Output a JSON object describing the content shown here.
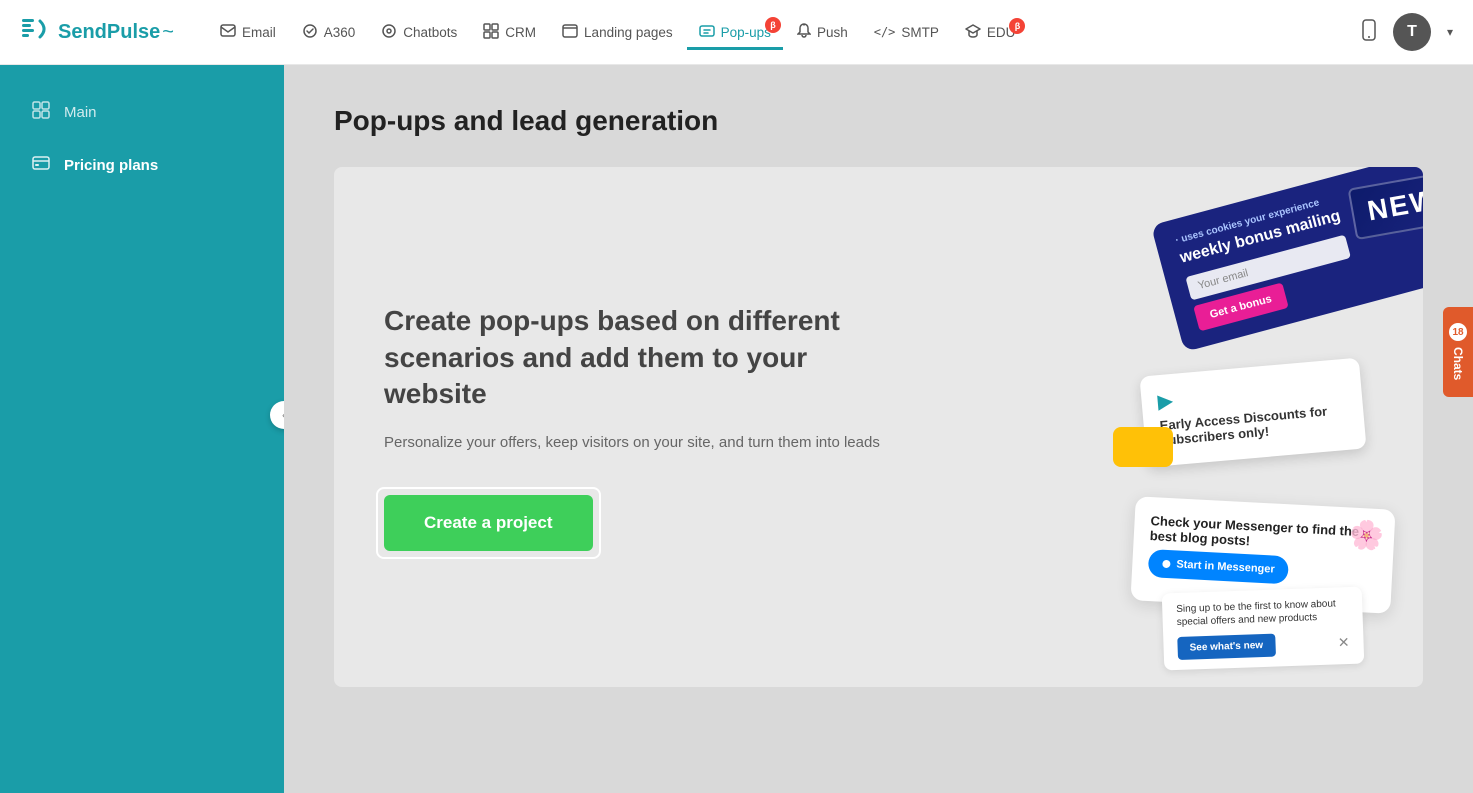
{
  "brand": {
    "name": "SendPulse",
    "logo_symbol": "⊞",
    "wave": "~"
  },
  "topnav": {
    "items": [
      {
        "id": "email",
        "label": "Email",
        "icon": "✉",
        "active": false,
        "beta": false
      },
      {
        "id": "a360",
        "label": "A360",
        "icon": "⟳",
        "active": false,
        "beta": false
      },
      {
        "id": "chatbots",
        "label": "Chatbots",
        "icon": "◎",
        "active": false,
        "beta": false
      },
      {
        "id": "crm",
        "label": "CRM",
        "icon": "⊞",
        "active": false,
        "beta": false
      },
      {
        "id": "landing",
        "label": "Landing pages",
        "icon": "⬜",
        "active": false,
        "beta": false
      },
      {
        "id": "popups",
        "label": "Pop-ups",
        "icon": "🖼",
        "active": true,
        "beta": true
      },
      {
        "id": "push",
        "label": "Push",
        "icon": "🔔",
        "active": false,
        "beta": false
      },
      {
        "id": "smtp",
        "label": "SMTP",
        "icon": "</>",
        "active": false,
        "beta": false
      },
      {
        "id": "edu",
        "label": "EDU",
        "icon": "🎓",
        "active": false,
        "beta": true
      }
    ],
    "avatar_letter": "T",
    "mobile_icon": "📱"
  },
  "sidebar": {
    "items": [
      {
        "id": "main",
        "label": "Main",
        "icon": "⊞",
        "active": false
      },
      {
        "id": "pricing",
        "label": "Pricing plans",
        "icon": "💳",
        "active": true
      }
    ],
    "collapse_label": "<"
  },
  "main": {
    "page_title": "Pop-ups and lead generation",
    "promo": {
      "title": "Create pop-ups based on different scenarios and add them to your website",
      "description": "Personalize your offers, keep visitors on your site, and turn them into leads",
      "cta_button": "Create a project"
    }
  },
  "chats": {
    "label": "Chats",
    "count": "18"
  }
}
